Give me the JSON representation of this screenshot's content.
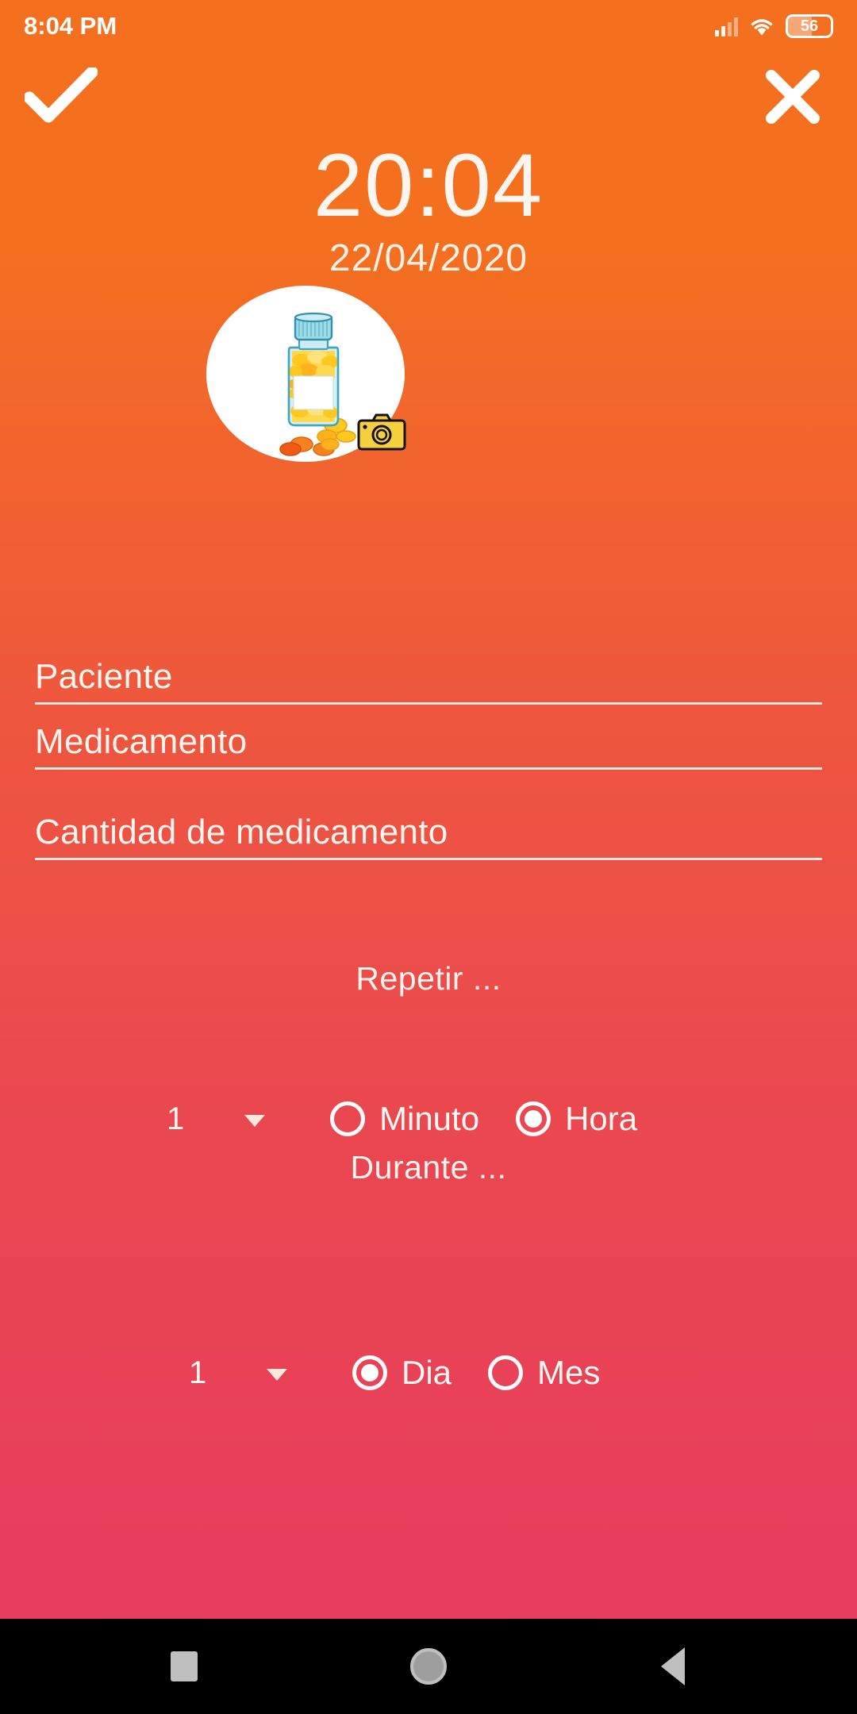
{
  "status_bar": {
    "time": "8:04 PM",
    "signal_icon": "signal-bars-icon",
    "wifi_icon": "wifi-icon",
    "battery_level": "56",
    "battery_icon": "battery-icon"
  },
  "action_bar": {
    "confirm_icon": "check-icon",
    "cancel_icon": "close-icon"
  },
  "header": {
    "time": "20:04",
    "date": "22/04/2020"
  },
  "avatar": {
    "image_name": "pill-bottle-illustration",
    "camera_icon": "camera-icon"
  },
  "form": {
    "fields": [
      {
        "name": "paciente",
        "placeholder": "Paciente",
        "value": ""
      },
      {
        "name": "medicamento",
        "placeholder": "Medicamento",
        "value": ""
      },
      {
        "name": "cantidad",
        "placeholder": "Cantidad de medicamento",
        "value": ""
      }
    ]
  },
  "repeat_section": {
    "title": "Repetir ...",
    "amount_value": "1",
    "dropdown_icon": "chevron-down-icon",
    "options": [
      {
        "label": "Minuto",
        "selected": false
      },
      {
        "label": "Hora",
        "selected": true
      }
    ]
  },
  "duration_section": {
    "title": "Durante ...",
    "amount_value": "1",
    "dropdown_icon": "chevron-down-icon",
    "options": [
      {
        "label": "Dia",
        "selected": true
      },
      {
        "label": "Mes",
        "selected": false
      }
    ]
  },
  "nav_bar": {
    "recents_icon": "square-recents-icon",
    "home_icon": "circle-home-icon",
    "back_icon": "triangle-back-icon"
  },
  "colors": {
    "gradient_top": "#F4701E",
    "gradient_bottom": "#E73B62",
    "text": "#FFFFFF",
    "camera_yellow": "#F6CF3F",
    "bottle_teal": "#8FD4E0",
    "pill_yellow": "#FFC81E",
    "pill_orange": "#F58220"
  }
}
